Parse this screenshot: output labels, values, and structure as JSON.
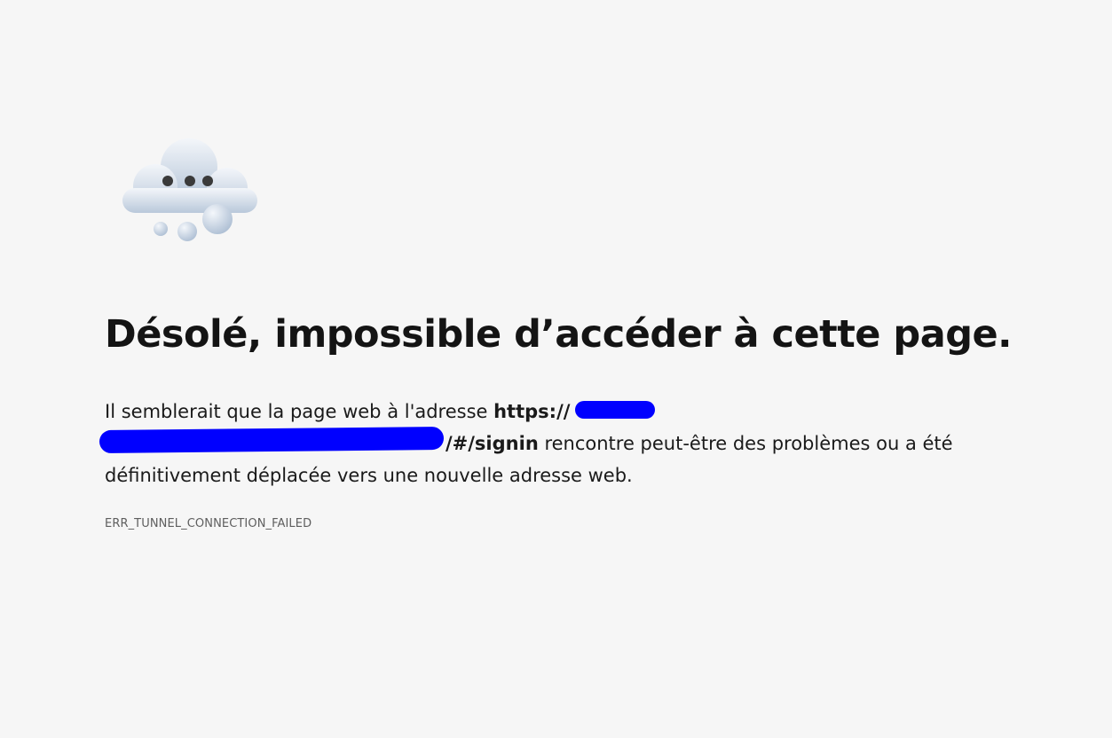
{
  "illustration": {
    "icon": "cloud-with-dots-icon"
  },
  "error": {
    "title": "Désolé, impossible d’accéder à cette page.",
    "message_prefix": "Il semblerait que la page web à l'adresse ",
    "url_start": "https://",
    "url_end": "/#/signin",
    "message_suffix": " rencontre peut-être des problèmes ou a été définitivement déplacée vers une nouvelle adresse web.",
    "code": "ERR_TUNNEL_CONNECTION_FAILED"
  },
  "colors": {
    "background": "#f6f6f6",
    "redaction": "#0000ff"
  }
}
